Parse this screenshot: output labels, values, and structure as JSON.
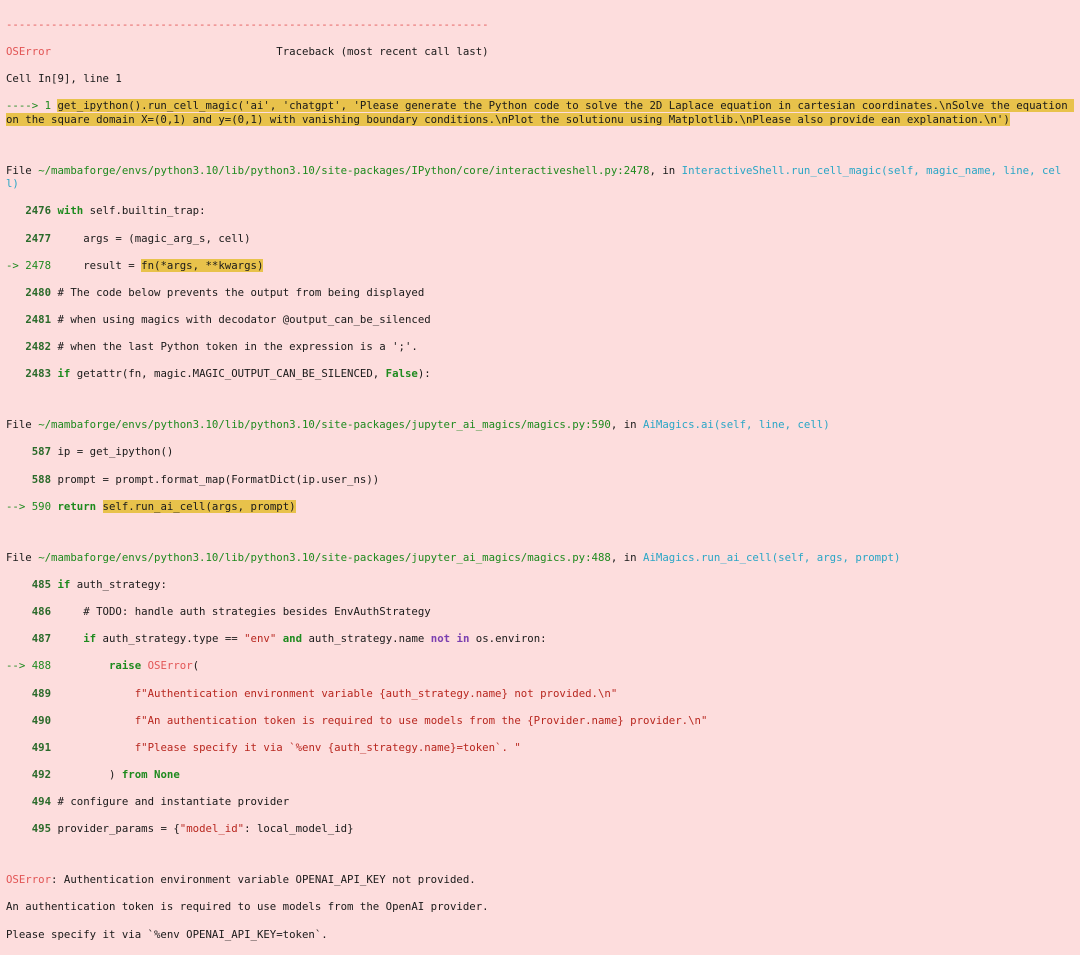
{
  "sep": "---------------------------------------------------------------------------",
  "err_name": "OSError",
  "tb_header": "Traceback (most recent call last)",
  "cell_ref": "Cell In[9], line 1",
  "f1": {
    "arrow": "----> 1 ",
    "code": "get_ipython().run_cell_magic('ai', 'chatgpt', 'Please generate the Python code to solve the 2D Laplace equation in cartesian coordinates.\\nSolve the equation on the square domain X=(0,1) and y=(0,1) with vanishing boundary conditions.\\nPlot the solutionu using Matplotlib.\\nPlease also provide ean explanation.\\n')"
  },
  "f2": {
    "prefix": "File ",
    "path": "~/mambaforge/envs/python3.10/lib/python3.10/site-packages/IPython/core/interactiveshell.py:2478",
    "in": ", in ",
    "func": "InteractiveShell.run_cell_magic(self, magic_name, line, cell)",
    "l2476n": "2476",
    "l2476k": "with",
    "l2476a": " self",
    "l2476b": ".builtin_trap:",
    "l2477n": "2477",
    "l2477": "     args = (magic_arg_s, cell)",
    "l2478a": "-> 2478",
    "l2478b": "     result = ",
    "l2478c": "fn(*args, **kwargs)",
    "l2480n": "2480",
    "l2480": " # The code below prevents the output from being displayed",
    "l2481n": "2481",
    "l2481": " # when using magics with decodator @output_can_be_silenced",
    "l2482n": "2482",
    "l2482": " # when the last Python token in the expression is a ';'.",
    "l2483n": "2483",
    "l2483k": "if",
    "l2483a": " getattr(fn, magic.MAGIC_OUTPUT_CAN_BE_SILENCED, ",
    "l2483f": "False",
    "l2483b": "):"
  },
  "f3": {
    "prefix": "File ",
    "path": "~/mambaforge/envs/python3.10/lib/python3.10/site-packages/jupyter_ai_magics/magics.py:590",
    "in": ", in ",
    "func": "AiMagics.ai(self, line, cell)",
    "l587n": "587",
    "l587": " ip = get_ipython()",
    "l588n": "588",
    "l588": " prompt = prompt.format_map(FormatDict(ip.user_ns))",
    "l590a": "--> 590",
    "l590k": "return",
    "l590c": "self.run_ai_cell(args, prompt)"
  },
  "f4": {
    "prefix": "File ",
    "path": "~/mambaforge/envs/python3.10/lib/python3.10/site-packages/jupyter_ai_magics/magics.py:488",
    "in": ", in ",
    "func": "AiMagics.run_ai_cell(self, args, prompt)",
    "l485n": "485",
    "l485k": "if",
    "l485": " auth_strategy:",
    "l486n": "486",
    "l486": "     # TODO: handle auth strategies besides EnvAuthStrategy",
    "l487n": "487",
    "l487k": "if",
    "l487a": " auth_strategy.type == ",
    "l487s": "\"env\"",
    "l487and": "and",
    "l487b": " auth_strategy.name ",
    "l487notin": "not in",
    "l487c": " os.environ:",
    "l488a": "--> 488",
    "l488k": "raise",
    "l488e": "OSError",
    "l488b": "(",
    "l489n": "489",
    "l489s": "f\"Authentication environment variable {auth_strategy.name} not provided.\\n\"",
    "l490n": "490",
    "l490s": "f\"An authentication token is required to use models from the {Provider.name} provider.\\n\"",
    "l491n": "491",
    "l491s": "f\"Please specify it via `%env {auth_strategy.name}=token`. \"",
    "l492n": "492",
    "l492a": "         ) ",
    "l492k": "from",
    "l492none": " None",
    "l494n": "494",
    "l494": " # configure and instantiate provider",
    "l495n": "495",
    "l495a": " provider_params = {",
    "l495s": "\"model_id\"",
    "l495b": ": local_model_id}"
  },
  "final": {
    "name": "OSError",
    "msg1": ": Authentication environment variable OPENAI_API_KEY not provided.",
    "msg2": "An authentication token is required to use models from the OpenAI provider.",
    "msg3": "Please specify it via `%env OPENAI_API_KEY=token`."
  }
}
